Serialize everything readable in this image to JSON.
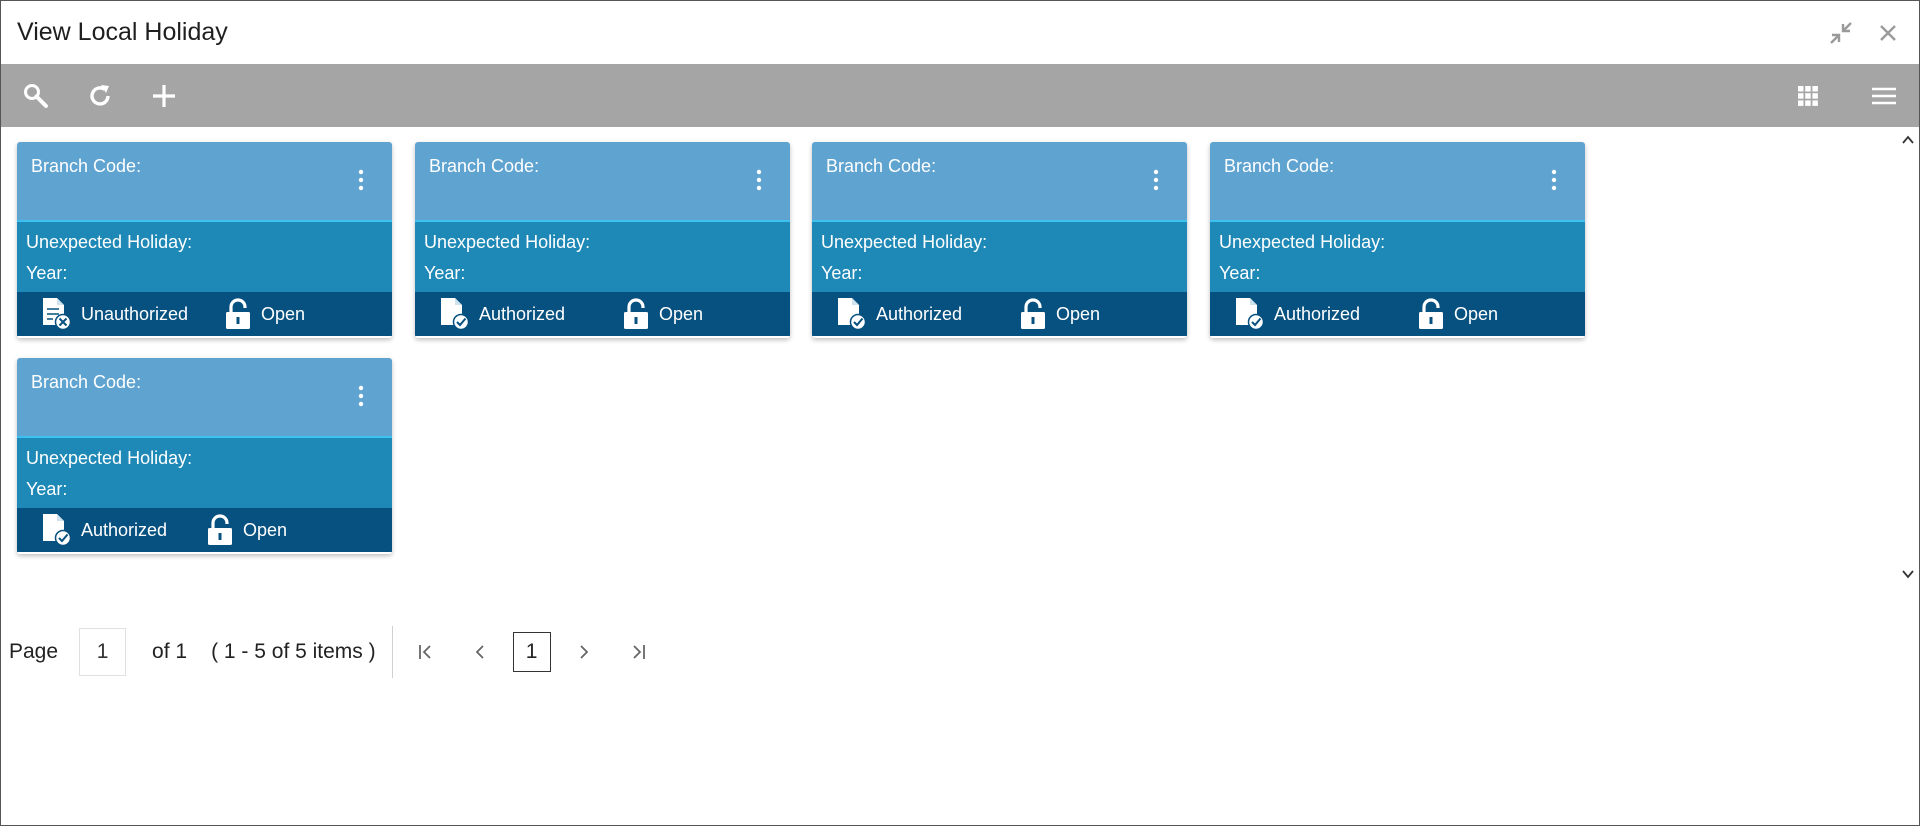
{
  "window": {
    "title": "View Local Holiday",
    "icons": [
      "minimize-icon",
      "close-icon"
    ]
  },
  "toolbar": {
    "left": [
      "search-icon",
      "refresh-icon",
      "add-icon"
    ],
    "right": [
      "grid-view-icon",
      "list-view-icon"
    ]
  },
  "tiles": [
    {
      "branch_label": "Branch Code:",
      "holiday_label": "Unexpected Holiday:",
      "year_label": "Year:",
      "auth_status": "Unauthorized",
      "record_status": "Open"
    },
    {
      "branch_label": "Branch Code:",
      "holiday_label": "Unexpected Holiday:",
      "year_label": "Year:",
      "auth_status": "Authorized",
      "record_status": "Open"
    },
    {
      "branch_label": "Branch Code:",
      "holiday_label": "Unexpected Holiday:",
      "year_label": "Year:",
      "auth_status": "Authorized",
      "record_status": "Open"
    },
    {
      "branch_label": "Branch Code:",
      "holiday_label": "Unexpected Holiday:",
      "year_label": "Year:",
      "auth_status": "Authorized",
      "record_status": "Open"
    },
    {
      "branch_label": "Branch Code:",
      "holiday_label": "Unexpected Holiday:",
      "year_label": "Year:",
      "auth_status": "Authorized",
      "record_status": "Open"
    }
  ],
  "pager": {
    "page_label": "Page",
    "page_value": "1",
    "of_label": "of 1",
    "range_label": "( 1 - 5 of 5 items )",
    "current_page": "1"
  },
  "colors": {
    "toolbar": "#a5a5a5",
    "tile_head": "#5fa3d0",
    "tile_mid": "#1e88b6",
    "tile_foot": "#075180"
  }
}
